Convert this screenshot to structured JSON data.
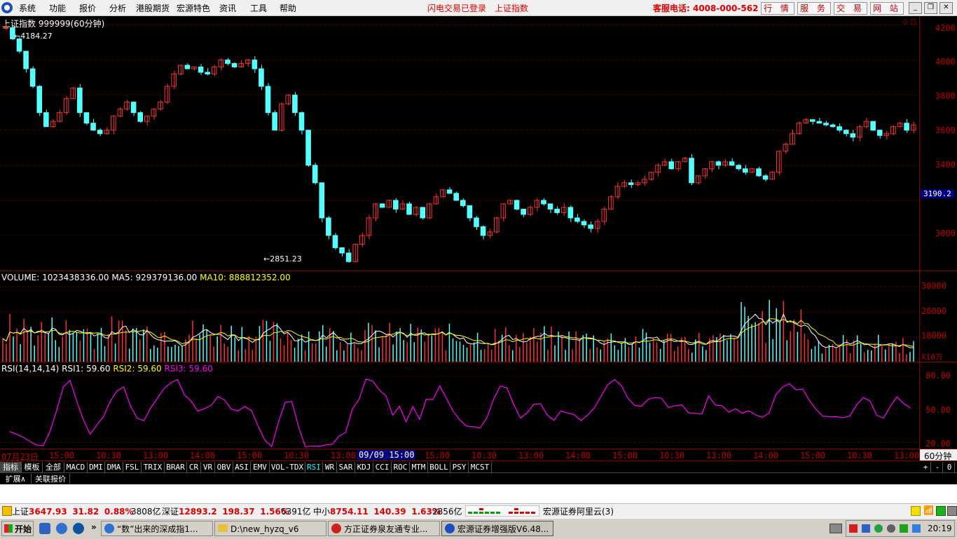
{
  "menu": [
    "系统",
    "功能",
    "报价",
    "分析",
    "港股期货",
    "宏源特色",
    "资讯",
    "工具",
    "帮助"
  ],
  "status_msg": "闪电交易已登录",
  "index_name_top": "上证指数",
  "hotline": "客服电话: 4008-000-562",
  "top_buttons": [
    "行 情",
    "服 务",
    "交 易",
    "网 站"
  ],
  "chart_title": "上证指数 999999(60分钟)",
  "high_marker": "4184.27",
  "low_marker": "2851.23",
  "price_axis": [
    "4200",
    "4000",
    "3800",
    "3600",
    "3400",
    "3000"
  ],
  "price_range": [
    2800,
    4250
  ],
  "last_price": "3190.2",
  "volume": {
    "label": "VOLUME:",
    "value": "1023438336.00",
    "ma5_label": "MA5:",
    "ma5": "929379136.00",
    "ma10_label": "MA10:",
    "ma10": "888812352.00",
    "axis": [
      "30000",
      "20000",
      "10000"
    ],
    "unit": "X10万"
  },
  "rsi": {
    "label": "RSI(14,14,14)",
    "rsi1_label": "RSI1:",
    "rsi1": "59.60",
    "rsi2_label": "RSI2:",
    "rsi2": "59.60",
    "rsi3_label": "RSI3:",
    "rsi3": "59.60",
    "axis": [
      "80.00",
      "50.00",
      "20.00"
    ]
  },
  "time_axis": [
    "07月23日",
    "15:00",
    "10:30",
    "13:00",
    "14:00",
    "15:00",
    "10:30",
    "13:00",
    "09/09 15:00",
    "15:00",
    "10:30",
    "13:00",
    "14:00",
    "15:00",
    "10:30",
    "13:00",
    "14:00",
    "15:00",
    "10:30",
    "13:00"
  ],
  "period": "60分钟",
  "tabs": [
    "指标",
    "模板",
    "全部",
    "MACD",
    "DMI",
    "DMA",
    "FSL",
    "TRIX",
    "BRAR",
    "CR",
    "VR",
    "OBV",
    "ASI",
    "EMV",
    "VOL-TDX",
    "RSI",
    "WR",
    "SAR",
    "KDJ",
    "CCI",
    "ROC",
    "MTM",
    "BOLL",
    "PSY",
    "MCST"
  ],
  "tab_controls": [
    "+",
    "-",
    "0"
  ],
  "ext_tabs": [
    "扩展∧",
    "关联报价"
  ],
  "quotes": [
    {
      "name": "上证",
      "price": "3647.93",
      "chg": "31.82",
      "pct": "0.88%",
      "amount": "3808亿"
    },
    {
      "name": "深证",
      "price": "12893.2",
      "chg": "198.37",
      "pct": "1.56%",
      "amount": "6391亿"
    },
    {
      "name": "中小",
      "price": "8754.11",
      "chg": "140.39",
      "pct": "1.63%",
      "amount": "2856亿"
    }
  ],
  "broker_text": "宏源证券阿里云(3)",
  "taskbar": {
    "start": "开始",
    "tasks": [
      "“数”出来的深成指1...",
      "D:\\new_hyzq_v6",
      "方正证券泉友通专业...",
      "宏源证券增强版V6.48..."
    ],
    "clock": "20:19"
  },
  "chart_data": {
    "type": "candlestick",
    "title": "上证指数 999999(60分钟)",
    "ylim": [
      2800,
      4250
    ],
    "points": [
      4184,
      4120,
      4050,
      3950,
      3850,
      3700,
      3620,
      3650,
      3700,
      3780,
      3840,
      3700,
      3640,
      3600,
      3580,
      3600,
      3680,
      3720,
      3760,
      3700,
      3650,
      3680,
      3720,
      3760,
      3850,
      3920,
      3970,
      3950,
      3960,
      3930,
      3920,
      3960,
      4000,
      3980,
      3960,
      3980,
      4000,
      3950,
      3850,
      3700,
      3600,
      3750,
      3800,
      3700,
      3600,
      3400,
      3300,
      3100,
      3000,
      2930,
      2900,
      2851,
      2950,
      3000,
      3100,
      3180,
      3160,
      3200,
      3150,
      3180,
      3120,
      3160,
      3100,
      3180,
      3220,
      3260,
      3240,
      3200,
      3170,
      3100,
      3050,
      3000,
      3020,
      3100,
      3180,
      3200,
      3150,
      3120,
      3160,
      3200,
      3180,
      3150,
      3130,
      3160,
      3100,
      3080,
      3060,
      3040,
      3080,
      3150,
      3220,
      3280,
      3300,
      3290,
      3300,
      3320,
      3360,
      3400,
      3420,
      3380,
      3420,
      3440,
      3300,
      3340,
      3380,
      3420,
      3400,
      3420,
      3400,
      3380,
      3360,
      3380,
      3340,
      3320,
      3360,
      3480,
      3520,
      3580,
      3640,
      3660,
      3650,
      3640,
      3630,
      3620,
      3600,
      3580,
      3560,
      3620,
      3650,
      3600,
      3570,
      3580,
      3620,
      3640,
      3600,
      3630
    ]
  }
}
